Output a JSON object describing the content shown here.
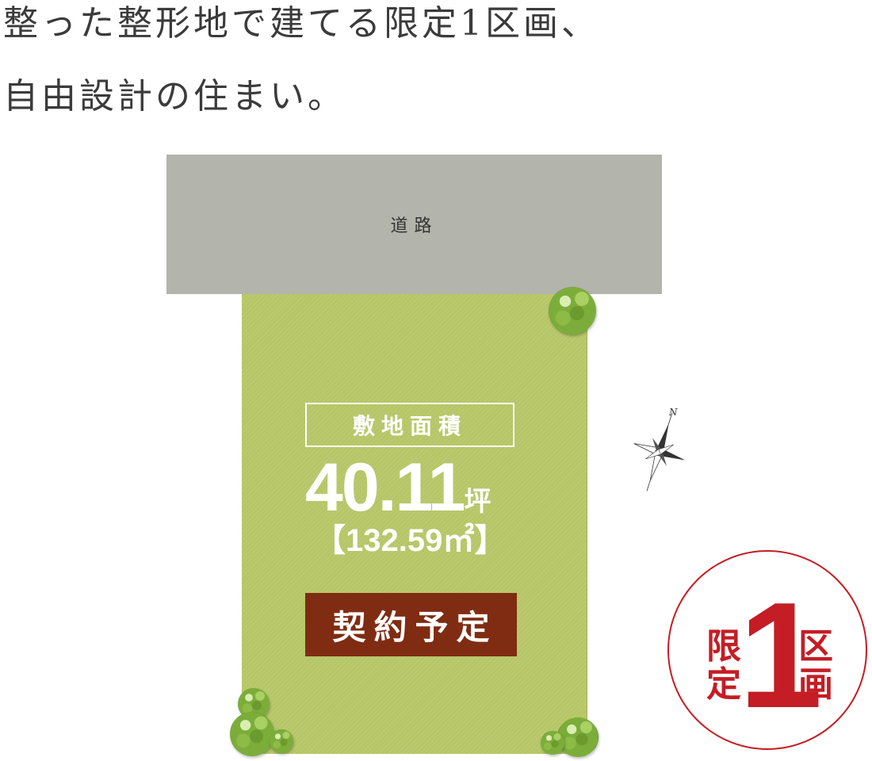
{
  "headline": {
    "line1": "整った整形地で建てる限定1区画、",
    "line2": "自由設計の住まい。"
  },
  "map": {
    "road_label": "道路",
    "compass_label": "N",
    "area_label": "敷地面積",
    "area_tsubo": "40.11",
    "area_tsubo_unit": "坪",
    "area_sqm": "【132.59㎡】",
    "status": "契約予定"
  },
  "badge": {
    "left_text": "限\n定",
    "number": "1",
    "right_text": "区\n画"
  },
  "colors": {
    "road": "#b3b4ab",
    "lot": "#b6c667",
    "status_bg": "#7f2c12",
    "badge_red": "#c41d25",
    "text_dark": "#3b3b3b"
  }
}
